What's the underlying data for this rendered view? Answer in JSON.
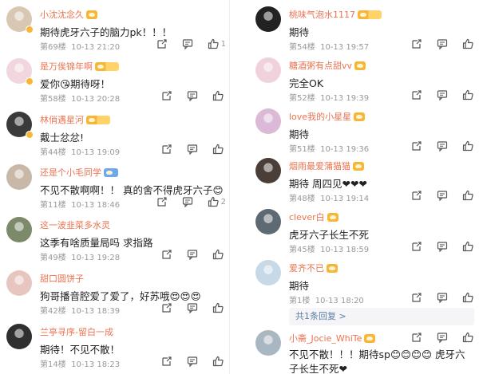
{
  "left_comments": [
    {
      "user": "小沈沈念久",
      "text": "期待虎牙六子的脑力pk！！！",
      "floor": "第69楼",
      "time": "10-13 21:20",
      "likes": "1",
      "avatar_color": "#d8c7b2",
      "badge": "plain"
    },
    {
      "user": "是万俟锦年啊",
      "text": "爱你😘期待呀！",
      "floor": "第58楼",
      "time": "10-13 20:28",
      "likes": "",
      "avatar_color": "#f1d6dd",
      "badge": "wide"
    },
    {
      "user": "林俏遇星河",
      "text": "戴士忿忿!",
      "floor": "第44楼",
      "time": "10-13 19:09",
      "likes": "",
      "avatar_color": "#3a3a3a",
      "badge": "wide"
    },
    {
      "user": "还是个小毛同学",
      "text": "不见不散啊啊！！ 真的舍不得虎牙六子😊",
      "floor": "第11楼",
      "time": "10-13 18:46",
      "likes": "2",
      "avatar_color": "#c9b8a8",
      "badge": "blue"
    },
    {
      "user": "这一波韭菜多水灵",
      "text": "这季有啥质量局吗 求指路",
      "floor": "第49楼",
      "time": "10-13 19:28",
      "likes": "",
      "avatar_color": "#7a8a6a",
      "badge": "none"
    },
    {
      "user": "甜口圆饼子",
      "text": "狗哥播音腔爱了爱了，好苏哦😍😍😍",
      "floor": "第42楼",
      "time": "10-13 18:39",
      "likes": "",
      "avatar_color": "#e7c6c0",
      "badge": "none"
    },
    {
      "user": "兰亭寻序-留白一成",
      "text": "期待！不见不散！",
      "floor": "第14楼",
      "time": "10-13 18:23",
      "likes": "",
      "avatar_color": "#2f2f2f",
      "badge": "none"
    }
  ],
  "right_comments": [
    {
      "user": "桃味气泡水1117",
      "text": "期待",
      "floor": "第54楼",
      "time": "10-13 19:57",
      "likes": "",
      "avatar_color": "#222222",
      "badge": "wide"
    },
    {
      "user": "糖酒粥有点甜vv",
      "text": "完全OK",
      "floor": "第52楼",
      "time": "10-13 19:39",
      "likes": "",
      "avatar_color": "#f0d2dc",
      "badge": "plain"
    },
    {
      "user": "love我的小星星",
      "text": "期待",
      "floor": "第51楼",
      "time": "10-13 19:36",
      "likes": "",
      "avatar_color": "#dcb9d6",
      "badge": "plain"
    },
    {
      "user": "烟雨最爱蒲猫猫",
      "text": "期待 周四见❤❤❤",
      "floor": "第48楼",
      "time": "10-13 19:14",
      "likes": "",
      "avatar_color": "#4a3f38",
      "badge": "plain"
    },
    {
      "user": "clever白",
      "text": "虎牙六子长生不死",
      "floor": "第45楼",
      "time": "10-13 18:59",
      "likes": "",
      "avatar_color": "#5d6a73",
      "badge": "plain"
    },
    {
      "user": "爱齐不已",
      "text": "期待",
      "floor": "第1楼",
      "time": "10-13 18:20",
      "likes": "",
      "avatar_color": "#c7d9e6",
      "badge": "plain",
      "reply": "共1条回复 >"
    },
    {
      "user": "小斋_Jocie_WhiTe",
      "text": "不见不散！！！期待sp😊😊😊😊 虎牙六子长生不死❤",
      "floor": "",
      "time": "",
      "likes": "",
      "avatar_color": "#a9b7c2",
      "badge": "plain"
    }
  ],
  "colors": {
    "username": "#eb7350",
    "meta": "#999999",
    "link": "#5a7fa7",
    "badge": "#f7b734"
  },
  "icons": {
    "share": "share-icon",
    "comment": "comment-icon",
    "like": "thumbs-up-icon",
    "verified": "verified-badge-icon"
  }
}
